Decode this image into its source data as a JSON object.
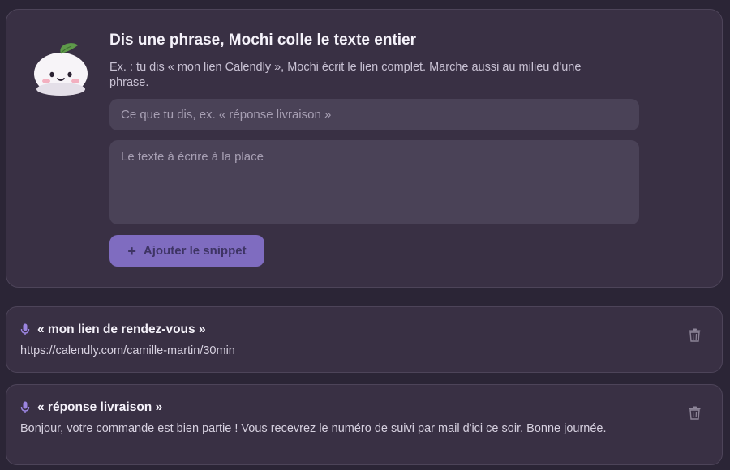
{
  "form": {
    "title": "Dis une phrase, Mochi colle le texte entier",
    "description": "Ex. : tu dis « mon lien Calendly », Mochi écrit le lien complet. Marche aussi au milieu d'une phrase.",
    "trigger_placeholder": "Ce que tu dis, ex. « réponse livraison »",
    "replacement_placeholder": "Le texte à écrire à la place",
    "add_label": "Ajouter le snippet",
    "mascot_icon": "mochi-mascot-icon",
    "add_icon": "plus-icon"
  },
  "snippets": [
    {
      "trigger": "« mon lien de rendez-vous »",
      "replacement": "https://calendly.com/camille-martin/30min",
      "trigger_icon": "microphone-icon",
      "delete_icon": "trash-icon"
    },
    {
      "trigger": "« réponse livraison »",
      "replacement": "Bonjour, votre commande est bien partie ! Vous recevrez le numéro de suivi par mail d'ici ce soir. Bonne journée.",
      "trigger_icon": "microphone-icon",
      "delete_icon": "trash-icon"
    }
  ],
  "colors": {
    "background": "#2b2536",
    "panel": "#393044",
    "field": "#4a4257",
    "accent": "#7f6cc0",
    "mic": "#9b84e0"
  }
}
